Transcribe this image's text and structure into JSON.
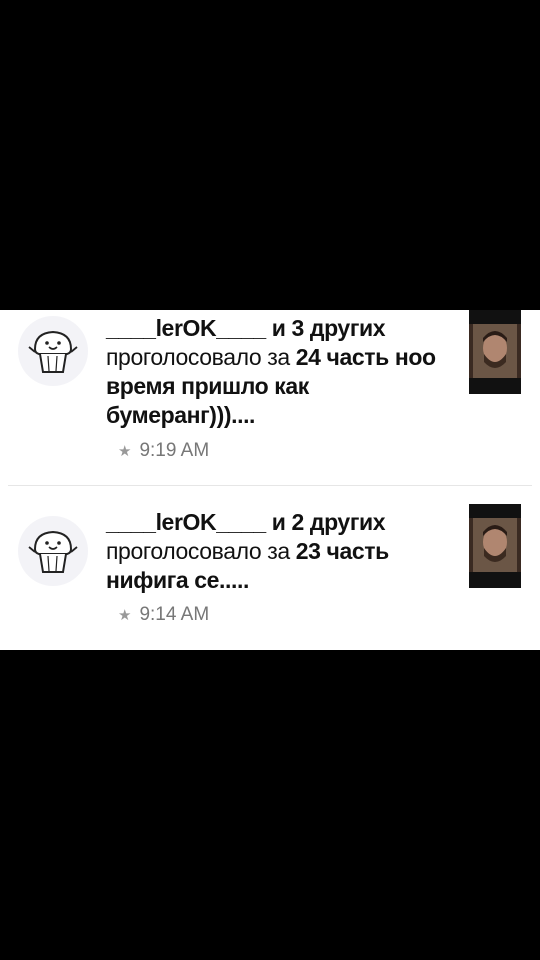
{
  "notifications": [
    {
      "user": "____lerOK____",
      "others": "и 3 других",
      "action": "проголосовало за",
      "part": "24 часть",
      "comment": "ноо время пришло как бумеранг)))....",
      "time": "9:19 AM"
    },
    {
      "user": "____lerOK____",
      "others": "и 2 других",
      "action": "проголосовало за",
      "part": "23 часть",
      "comment": "нифига се.....",
      "time": "9:14 AM"
    }
  ],
  "icons": {
    "avatar": "muffin-avatar-icon",
    "star": "star-icon",
    "thumbnail": "story-cover-thumbnail"
  }
}
